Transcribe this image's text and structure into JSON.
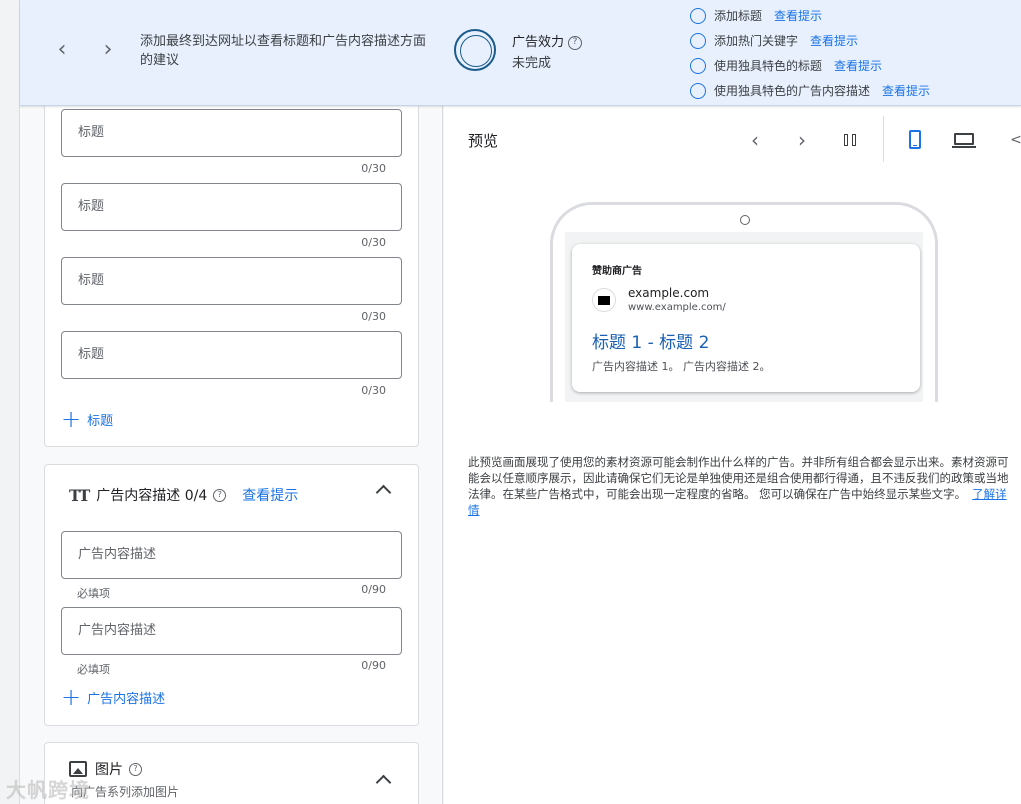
{
  "topbar": {
    "tip": "添加最终到达网址以查看标题和广告内容描述方面的建议",
    "effectiveness_label": "广告效力",
    "effectiveness_status": "未完成",
    "checklist": [
      {
        "label": "添加标题",
        "link": "查看提示"
      },
      {
        "label": "添加热门关键字",
        "link": "查看提示"
      },
      {
        "label": "使用独具特色的标题",
        "link": "查看提示"
      },
      {
        "label": "使用独具特色的广告内容描述",
        "link": "查看提示"
      }
    ]
  },
  "headlines": {
    "fields": [
      {
        "placeholder": "标题",
        "counter": "0/30"
      },
      {
        "placeholder": "标题",
        "counter": "0/30"
      },
      {
        "placeholder": "标题",
        "counter": "0/30"
      },
      {
        "placeholder": "标题",
        "counter": "0/30"
      }
    ],
    "add_label": "标题"
  },
  "descriptions": {
    "title": "广告内容描述 0/4",
    "tips_link": "查看提示",
    "fields": [
      {
        "placeholder": "广告内容描述",
        "required": "必填项",
        "counter": "0/90"
      },
      {
        "placeholder": "广告内容描述",
        "required": "必填项",
        "counter": "0/90"
      }
    ],
    "add_label": "广告内容描述"
  },
  "images": {
    "title": "图片",
    "subtitle": "向广告系列添加图片"
  },
  "preview": {
    "title": "预览",
    "ad": {
      "sponsored": "赞助商广告",
      "domain": "example.com",
      "url": "www.example.com/",
      "headline": "标题 1 - 标题 2",
      "description": "广告内容描述 1。 广告内容描述 2。"
    },
    "notice": "此预览画面展现了使用您的素材资源可能会制作出什么样的广告。并非所有组合都会显示出来。素材资源可能会以任意顺序展示，因此请确保它们无论是单独使用还是组合使用都行得通，且不违反我们的政策或当地法律。在某些广告格式中，可能会出现一定程度的省略。 您可以确保在广告中始终显示某些文字。",
    "notice_link": "了解详情"
  },
  "watermark": "大帆跨境"
}
